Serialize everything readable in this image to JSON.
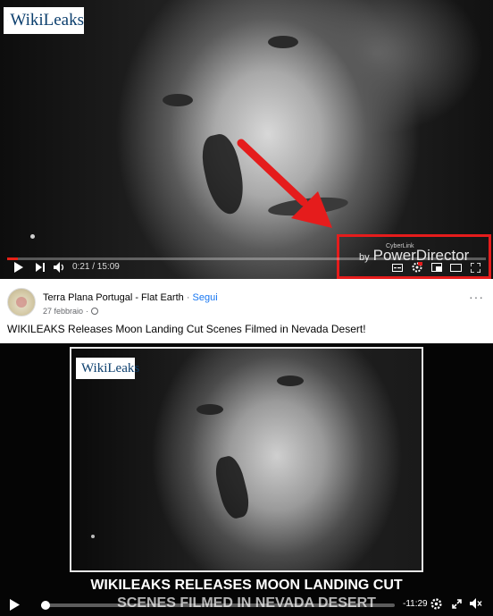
{
  "top_video": {
    "watermark_logo": "WikiLeaks",
    "brand_small": "CyberLink",
    "brand_by": "by",
    "brand_name": "PowerDirector",
    "time_display": "0:21 / 15:09",
    "progress_fraction": 0.023,
    "highlight_color": "#e51c1c",
    "icons": [
      "play-icon",
      "next-icon",
      "volume-icon",
      "subtitles-icon",
      "settings-icon",
      "miniplayer-icon",
      "theater-icon",
      "fullscreen-icon"
    ]
  },
  "post": {
    "page_name": "Terra Plana Portugal - Flat Earth",
    "separator": "·",
    "follow_label": "Segui",
    "date": "27 febbraio",
    "date_sep": "·",
    "title": "WIKILEAKS Releases Moon Landing Cut Scenes Filmed in Nevada Desert!",
    "more_label": "···"
  },
  "fb_video": {
    "watermark_logo": "WikiLeaks",
    "caption_line1": "WIKILEAKS RELEASES MOON LANDING CUT",
    "caption_line2": "SCENES FILMED IN NEVADA DESERT",
    "remaining_time": "-11:29",
    "progress_fraction": 0.02,
    "accent_color": "#1877f2"
  }
}
